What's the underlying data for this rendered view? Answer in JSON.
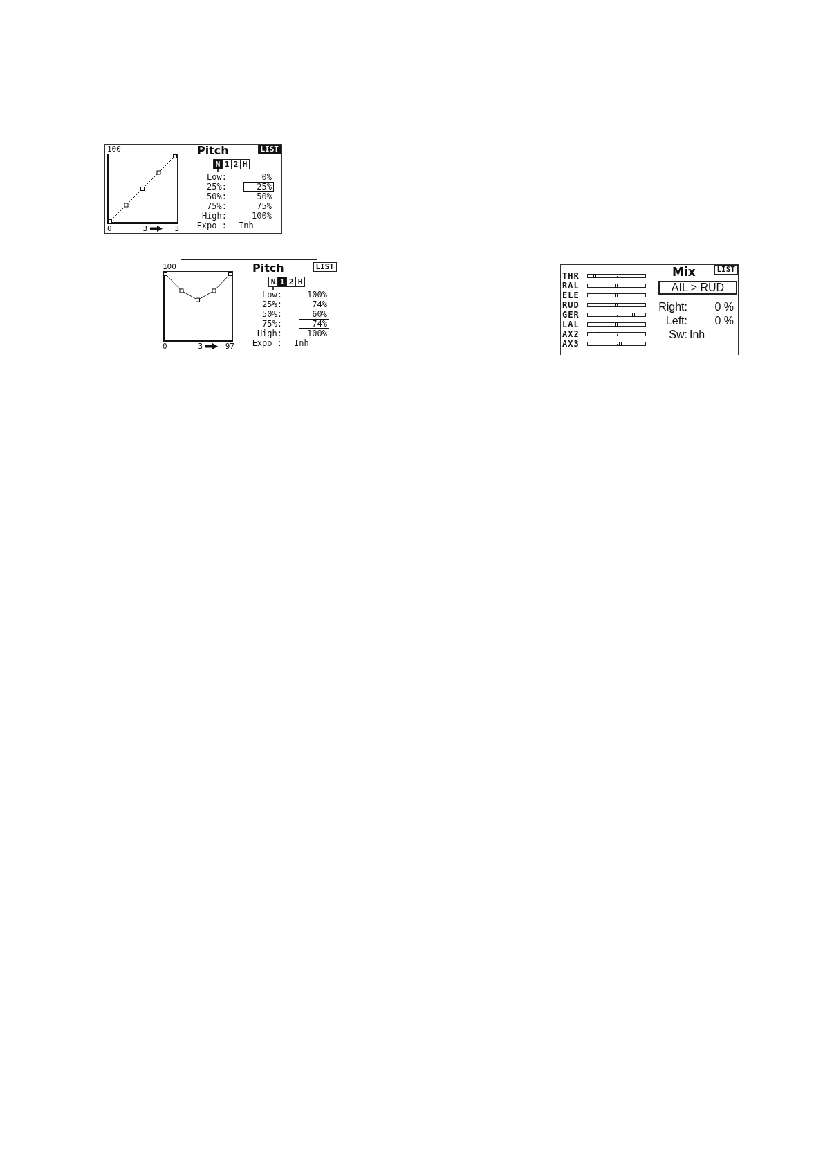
{
  "screens": [
    {
      "kind": "curve",
      "graph": {
        "top_label": "100",
        "bottom_label": "0",
        "readout": {
          "input": "3",
          "output": "3"
        }
      },
      "title": "Pitch",
      "list_button": {
        "label": "LIST",
        "selected": true
      },
      "modes": [
        {
          "label": "N",
          "selected": true,
          "current": true
        },
        {
          "label": "1",
          "selected": false,
          "current": false
        },
        {
          "label": "2",
          "selected": false,
          "current": false
        },
        {
          "label": "H",
          "selected": false,
          "current": false
        }
      ],
      "rows": [
        {
          "label": "Low:",
          "value": "0%",
          "selected": false
        },
        {
          "label": "25%:",
          "value": "25%",
          "selected": true
        },
        {
          "label": "50%:",
          "value": "50%",
          "selected": false
        },
        {
          "label": "75%:",
          "value": "75%",
          "selected": false
        },
        {
          "label": "High:",
          "value": "100%",
          "selected": false
        }
      ],
      "expo": {
        "label": "Expo :",
        "value": "Inh"
      }
    },
    {
      "kind": "curve",
      "graph": {
        "top_label": "100",
        "bottom_label": "0",
        "readout": {
          "input": "3",
          "output": "97"
        }
      },
      "title": "Pitch",
      "list_button": {
        "label": "LIST",
        "selected": false
      },
      "modes": [
        {
          "label": "N",
          "selected": false,
          "current": true
        },
        {
          "label": "1",
          "selected": true,
          "current": false
        },
        {
          "label": "2",
          "selected": false,
          "current": false
        },
        {
          "label": "H",
          "selected": false,
          "current": false
        }
      ],
      "rows": [
        {
          "label": "Low:",
          "value": "100%",
          "selected": false
        },
        {
          "label": "25%:",
          "value": "74%",
          "selected": false
        },
        {
          "label": "50%:",
          "value": "60%",
          "selected": false
        },
        {
          "label": "75%:",
          "value": "74%",
          "selected": true
        },
        {
          "label": "High:",
          "value": "100%",
          "selected": false
        }
      ],
      "expo": {
        "label": "Expo :",
        "value": "Inh"
      }
    },
    {
      "kind": "mix",
      "channels": [
        {
          "name": "THR",
          "level": 0.12
        },
        {
          "name": "RAL",
          "level": 0.49
        },
        {
          "name": "ELE",
          "level": 0.49
        },
        {
          "name": "RUD",
          "level": 0.49
        },
        {
          "name": "GER",
          "level": 0.8
        },
        {
          "name": "LAL",
          "level": 0.49
        },
        {
          "name": "AX2",
          "level": 0.19
        },
        {
          "name": "AX3",
          "level": 0.57
        }
      ],
      "title": "Mix",
      "list_button": {
        "label": "LIST",
        "selected": false
      },
      "mix_field": {
        "value": "AIL > RUD"
      },
      "rows": [
        {
          "label": "Right:",
          "value": "0 %"
        },
        {
          "label": "Left:",
          "value": "0 %"
        }
      ],
      "switch": {
        "label": "Sw:",
        "value": "Inh"
      }
    }
  ]
}
